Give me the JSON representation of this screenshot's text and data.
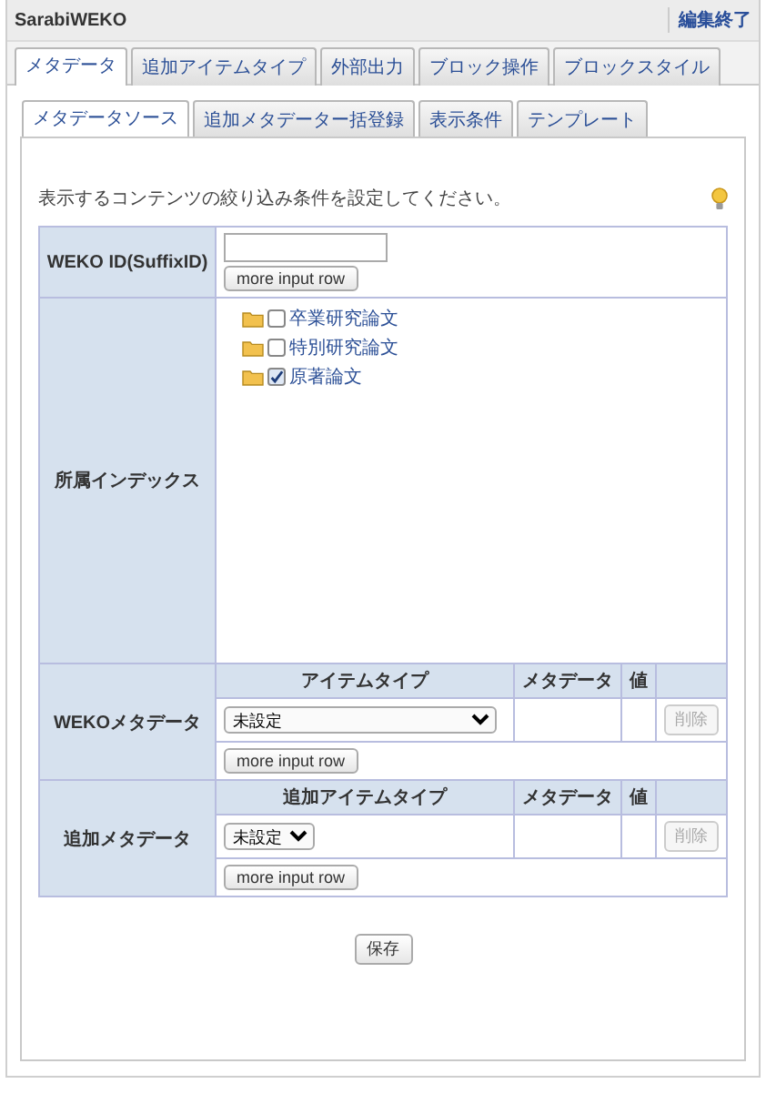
{
  "header": {
    "title": "SarabiWEKO",
    "action": "編集終了"
  },
  "tabs": [
    {
      "label": "メタデータ",
      "selected": true
    },
    {
      "label": "追加アイテムタイプ",
      "selected": false
    },
    {
      "label": "外部出力",
      "selected": false
    },
    {
      "label": "ブロック操作",
      "selected": false
    },
    {
      "label": "ブロックスタイル",
      "selected": false
    }
  ],
  "subtabs": [
    {
      "label": "メタデータソース",
      "selected": true
    },
    {
      "label": "追加メタデーター括登録",
      "selected": false
    },
    {
      "label": "表示条件",
      "selected": false
    },
    {
      "label": "テンプレート",
      "selected": false
    }
  ],
  "instruction": "表示するコンテンツの絞り込み条件を設定してください。",
  "weko_id": {
    "label": "WEKO ID(SuffixID)",
    "button": "more input row"
  },
  "index": {
    "label": "所属インデックス",
    "items": [
      {
        "label": "卒業研究論文",
        "checked": false
      },
      {
        "label": "特別研究論文",
        "checked": false
      },
      {
        "label": "原著論文",
        "checked": true
      }
    ]
  },
  "meta_sections": [
    {
      "label": "WEKOメタデータ",
      "columns": [
        "アイテムタイプ",
        "メタデータ",
        "値"
      ],
      "select": "未設定",
      "wide_select": true,
      "delete": {
        "label": "削除",
        "disabled": true
      },
      "button": "more input row"
    },
    {
      "label": "追加メタデータ",
      "columns": [
        "追加アイテムタイプ",
        "メタデータ",
        "値"
      ],
      "select": "未設定",
      "wide_select": false,
      "delete": {
        "label": "削除",
        "disabled": true
      },
      "button": "more input row"
    }
  ],
  "save_button": "保存"
}
